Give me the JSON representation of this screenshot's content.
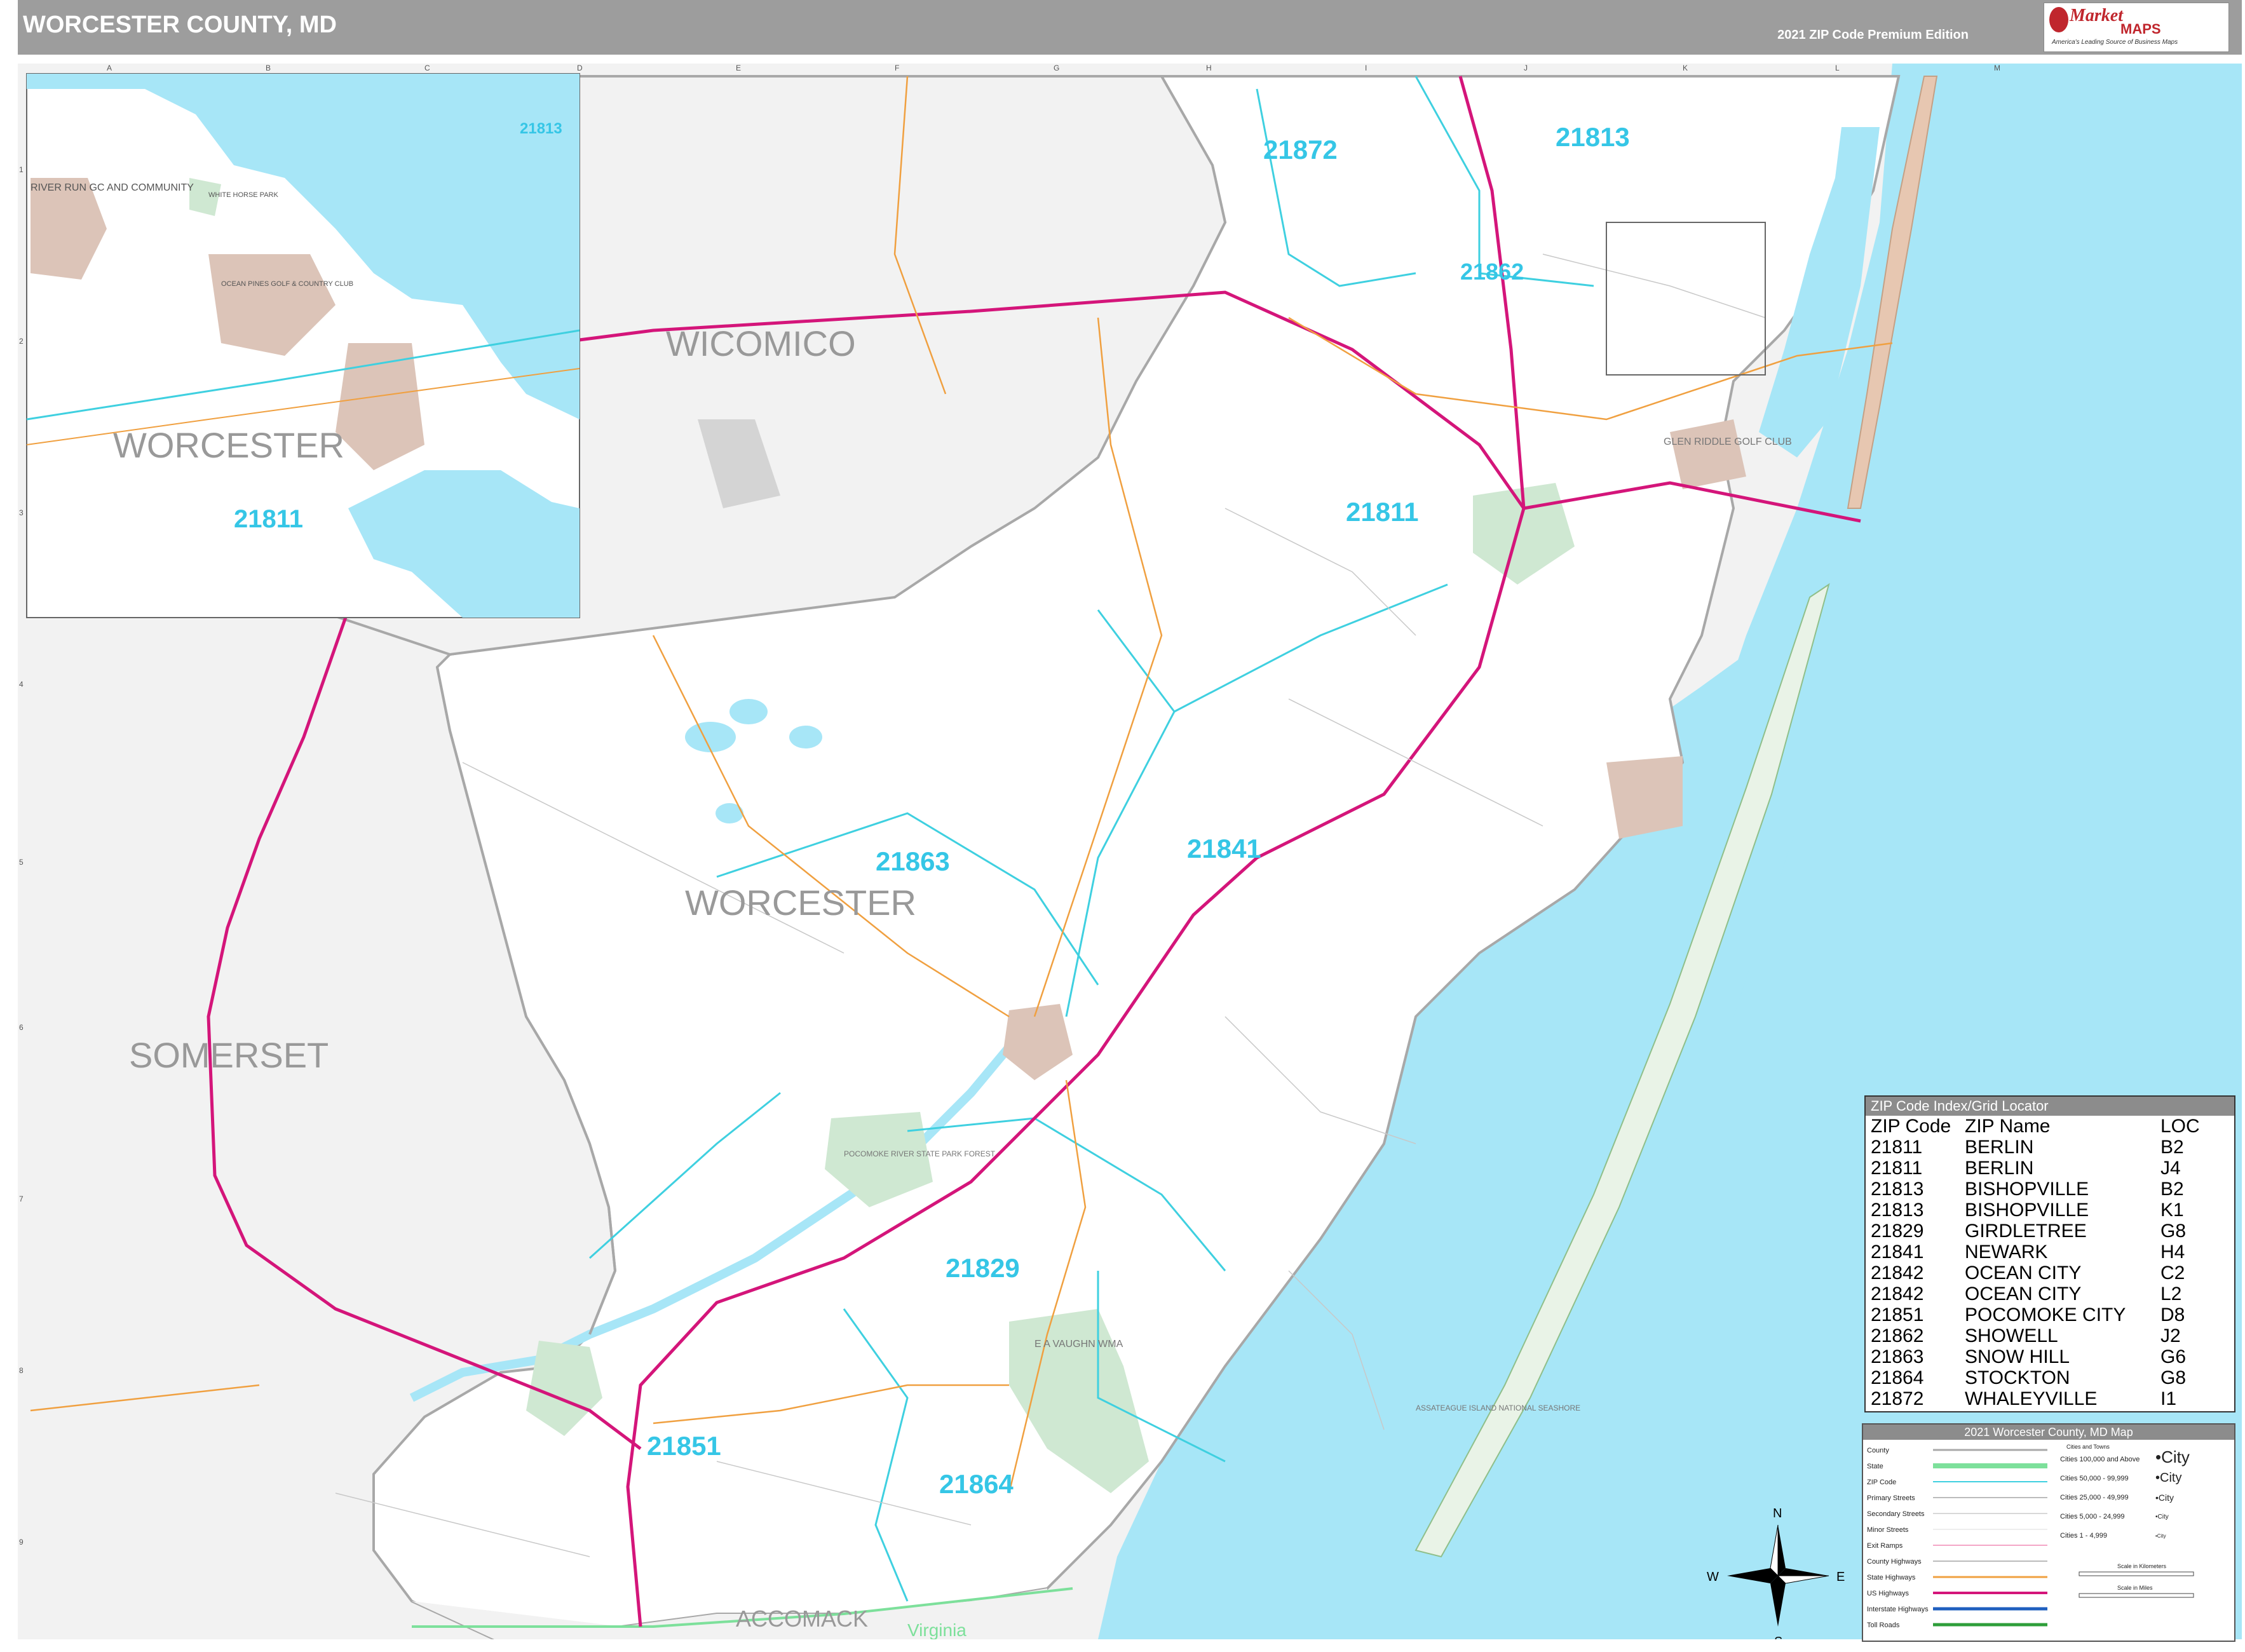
{
  "header": {
    "title": "WORCESTER COUNTY, MD",
    "edition": "2021 ZIP Code Premium Edition"
  },
  "logo": {
    "brand_top": "Market",
    "brand_bottom": "MAPS",
    "tagline": "America's Leading Source of Business Maps"
  },
  "grid": {
    "columns": [
      "A",
      "B",
      "C",
      "D",
      "E",
      "F",
      "G",
      "H",
      "I",
      "J",
      "K",
      "L",
      "M"
    ],
    "rows": [
      "1",
      "2",
      "3",
      "4",
      "5",
      "6",
      "7",
      "8",
      "9"
    ]
  },
  "map_labels": {
    "counties": {
      "wicomico": "WICOMICO",
      "worcester": "WORCESTER",
      "somerset": "SOMERSET",
      "accomack": "ACCOMACK",
      "virginia": "Virginia"
    },
    "zips": {
      "z21872": "21872",
      "z21813": "21813",
      "z21862": "21862",
      "z21811": "21811",
      "z21863": "21863",
      "z21841": "21841",
      "z21829": "21829",
      "z21851": "21851",
      "z21864": "21864"
    },
    "parks": {
      "gleniriddle": "GLEN RIDDLE GOLF CLUB",
      "pocomoke_forest": "POCOMOKE RIVER STATE PARK FOREST",
      "ea_vaughn": "E A VAUGHN WMA",
      "assateague": "ASSATEAGUE ISLAND NATIONAL SEASHORE"
    }
  },
  "inset": {
    "county_label": "WORCESTER",
    "zip_21813": "21813",
    "zip_21811": "21811",
    "river_run": "RIVER RUN GC AND COMMUNITY",
    "white_horse": "WHITE HORSE PARK",
    "ocean_pines": "OCEAN PINES GOLF & COUNTRY CLUB"
  },
  "zip_index": {
    "title": "ZIP Code Index/Grid Locator",
    "headers": [
      "ZIP Code",
      "ZIP Name",
      "LOC"
    ],
    "rows": [
      [
        "21811",
        "BERLIN",
        "B2"
      ],
      [
        "21811",
        "BERLIN",
        "J4"
      ],
      [
        "21813",
        "BISHOPVILLE",
        "B2"
      ],
      [
        "21813",
        "BISHOPVILLE",
        "K1"
      ],
      [
        "21829",
        "GIRDLETREE",
        "G8"
      ],
      [
        "21841",
        "NEWARK",
        "H4"
      ],
      [
        "21842",
        "OCEAN CITY",
        "C2"
      ],
      [
        "21842",
        "OCEAN CITY",
        "L2"
      ],
      [
        "21851",
        "POCOMOKE CITY",
        "D8"
      ],
      [
        "21862",
        "SHOWELL",
        "J2"
      ],
      [
        "21863",
        "SNOW HILL",
        "G6"
      ],
      [
        "21864",
        "STOCKTON",
        "G8"
      ],
      [
        "21872",
        "WHALEYVILLE",
        "I1"
      ]
    ]
  },
  "map_legend": {
    "title": "2021 Worcester County, MD Map",
    "items": [
      "County",
      "State",
      "ZIP Code",
      "Primary Streets",
      "Secondary Streets",
      "Minor Streets",
      "Exit Ramps",
      "County Highways",
      "State Highways",
      "US Highways",
      "Interstate Highways",
      "Toll Roads"
    ],
    "cities_header": "Cities and Towns",
    "cities": [
      {
        "range": "Cities 100,000 and Above",
        "sample": "•City"
      },
      {
        "range": "Cities 50,000 - 99,999",
        "sample": "•City"
      },
      {
        "range": "Cities 25,000 - 49,999",
        "sample": "•City"
      },
      {
        "range": "Cities 5,000 - 24,999",
        "sample": "•City"
      },
      {
        "range": "Cities 1 - 4,999",
        "sample": "•City"
      }
    ],
    "scale_km": "Scale in Kilometers",
    "scale_mi": "Scale in Miles"
  },
  "compass": {
    "n": "N",
    "s": "S",
    "e": "E",
    "w": "W"
  },
  "colors": {
    "water": "#a7e6f7",
    "land": "#ffffff",
    "outside_land": "#f2f2f2",
    "zip_boundary": "#3fd0e0",
    "zip_label": "#35c6e6",
    "county_boundary": "#a8a8a8",
    "us_highway": "#d4157a",
    "state_highway": "#f0a040",
    "park": "#cfe8d2",
    "urban": "#dcc4b8"
  }
}
